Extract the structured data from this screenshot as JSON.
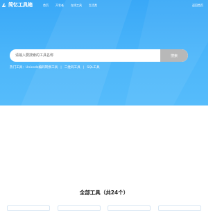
{
  "header": {
    "logo_text": "简忆工具箱",
    "nav": [
      "首页",
      "开发者",
      "在线工具",
      "生活类"
    ],
    "back_link": "返回首页"
  },
  "search": {
    "placeholder": "请输入要搜索的工具名称",
    "button_label": "搜索"
  },
  "hot": {
    "label": "热门工具：",
    "links": [
      "Unicode编码转换工具",
      "二维码工具",
      "SQL工具"
    ],
    "separator": "|"
  },
  "tools_section": {
    "title": "全部工具（共24个）"
  },
  "colors": {
    "hero": "#45b1f9",
    "search_button": "#b8b8b8"
  }
}
